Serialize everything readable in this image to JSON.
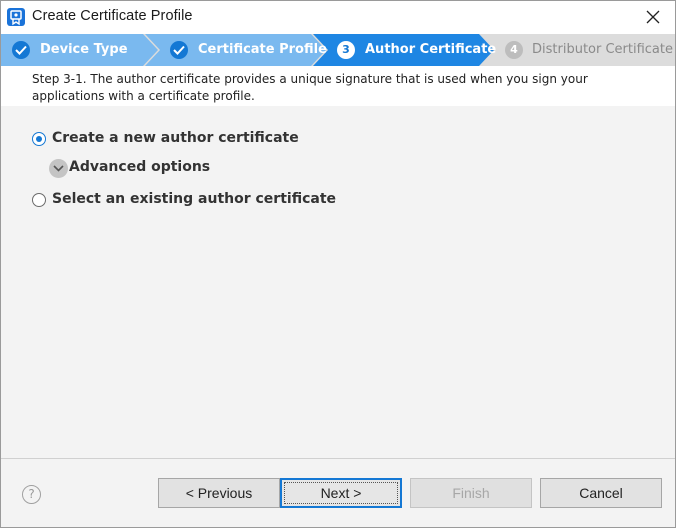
{
  "window": {
    "title": "Create Certificate Profile"
  },
  "steps": [
    {
      "number": "1",
      "label": "Device Type",
      "state": "done"
    },
    {
      "number": "2",
      "label": "Certificate Profile",
      "state": "done"
    },
    {
      "number": "3",
      "label": "Author Certificate",
      "state": "current"
    },
    {
      "number": "4",
      "label": "Distributor Certificate",
      "state": "pending"
    }
  ],
  "description": "Step 3-1. The author certificate provides a unique signature that is used when you sign your applications with a certificate profile.",
  "options": {
    "create_new": {
      "label": "Create a new author certificate",
      "selected": true
    },
    "advanced": {
      "label": "Advanced options",
      "expanded": false
    },
    "select_existing": {
      "label": "Select an existing author certificate",
      "selected": false
    }
  },
  "footer": {
    "help_symbol": "?",
    "previous_label": "< Previous",
    "next_label": "Next >",
    "finish_label": "Finish",
    "cancel_label": "Cancel"
  },
  "colors": {
    "accent": "#1478d4",
    "step_done": "#7ab9ef",
    "step_current": "#1e86e3",
    "step_pending": "#dcdcdc"
  }
}
